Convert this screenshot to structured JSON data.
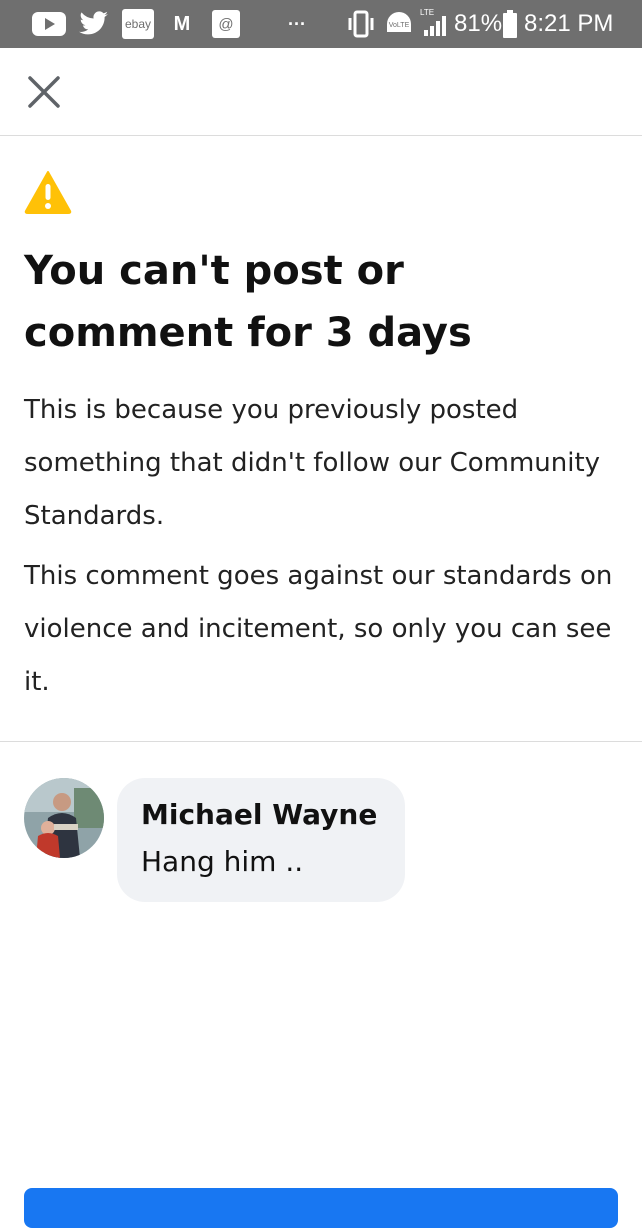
{
  "status_bar": {
    "icons": [
      "youtube-icon",
      "twitter-icon",
      "ebay-icon",
      "gmail-icon",
      "email-icon",
      "more-icon",
      "vibrate-icon",
      "volte-icon",
      "lte-signal-icon",
      "battery-icon"
    ],
    "ebay_label": "ebay",
    "gmail_label": "M",
    "email_label": "@",
    "more_label": "···",
    "volte_label": "VoLTE",
    "lte_label": "LTE",
    "battery": "81%",
    "time": "8:21 PM",
    "background_color": "#6f6f6f"
  },
  "top_bar": {
    "close_icon": "close-icon"
  },
  "notice": {
    "icon": "warning-icon",
    "icon_color": "#ffc107",
    "title": "You can't post or comment for 3 days",
    "paragraph_1": "This is because you previously posted something that didn't follow our Community Standards.",
    "paragraph_2": "This comment goes against our standards on violence and incitement, so only you can see it."
  },
  "comment": {
    "author": "Michael Wayne",
    "text": "Hang him ..",
    "bubble_color": "#f0f2f5"
  },
  "accent_color": "#1877f2"
}
